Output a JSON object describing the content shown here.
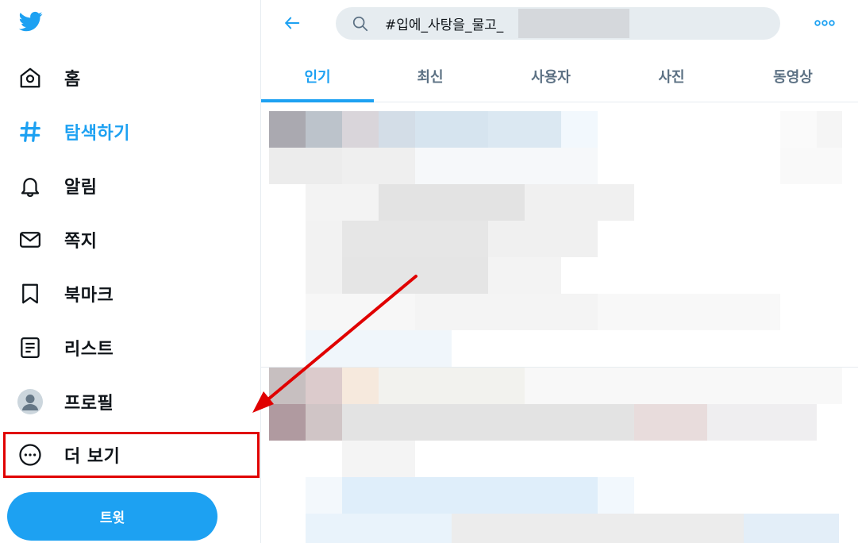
{
  "sidebar": {
    "logo_icon": "twitter-bird-icon",
    "items": [
      {
        "label": "홈",
        "icon": "home-icon"
      },
      {
        "label": "탐색하기",
        "icon": "hashtag-icon",
        "active": true
      },
      {
        "label": "알림",
        "icon": "bell-icon"
      },
      {
        "label": "쪽지",
        "icon": "envelope-icon"
      },
      {
        "label": "북마크",
        "icon": "bookmark-icon"
      },
      {
        "label": "리스트",
        "icon": "list-icon"
      },
      {
        "label": "프로필",
        "icon": "avatar-icon"
      },
      {
        "label": "더 보기",
        "icon": "more-circle-icon"
      }
    ],
    "tweet_button": "트윗"
  },
  "header": {
    "search_value": "#입에_사탕을_물고_"
  },
  "tabs": [
    {
      "label": "인기",
      "active": true
    },
    {
      "label": "최신"
    },
    {
      "label": "사용자"
    },
    {
      "label": "사진"
    },
    {
      "label": "동영상"
    }
  ],
  "colors": {
    "accent": "#1da1f2",
    "highlight_box": "#e00000",
    "arrow": "#e00000"
  }
}
